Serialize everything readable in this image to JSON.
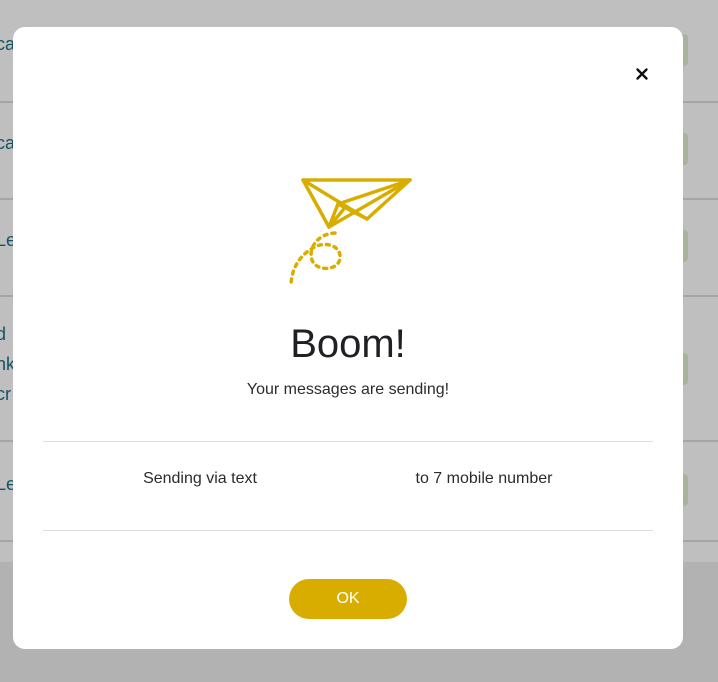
{
  "background": {
    "rows": [
      {
        "label": "ca"
      },
      {
        "label": "ca"
      },
      {
        "label": "Le"
      },
      {
        "label": "d"
      },
      {
        "label": "nk"
      },
      {
        "label": "cr"
      },
      {
        "label": "Le"
      }
    ]
  },
  "modal": {
    "close_icon": "close-icon",
    "illustration": "paper-plane-icon",
    "accent_color": "#d9ad00",
    "title": "Boom!",
    "subtitle": "Your messages are sending!",
    "sending_method": "Sending via text",
    "recipients": "to 7 mobile number",
    "ok_label": "OK"
  }
}
